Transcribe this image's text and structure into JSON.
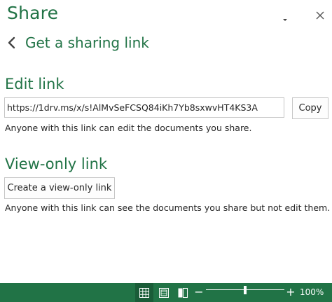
{
  "pane": {
    "title": "Share",
    "menu_icon": "chevron-down-icon",
    "close_icon": "close-icon"
  },
  "subheader": {
    "back_icon": "chevron-left-icon",
    "label": "Get a sharing link"
  },
  "edit_link": {
    "heading": "Edit link",
    "url": "https://1drv.ms/x/s!AlMvSeFCSQ84iKh7Yb8sxwvHT4KS3A",
    "copy_label": "Copy",
    "description": "Anyone with this link can edit the documents you share."
  },
  "view_only_link": {
    "heading": "View-only link",
    "create_label": "Create a view-only link",
    "description": "Anyone with this link can see the documents you share but not edit them."
  },
  "status_bar": {
    "views": [
      {
        "name": "normal-view",
        "icon": "grid-icon",
        "active": true
      },
      {
        "name": "page-layout-view",
        "icon": "page-layout-icon",
        "active": false
      },
      {
        "name": "page-break-preview",
        "icon": "page-break-icon",
        "active": false
      }
    ],
    "zoom_out": "−",
    "zoom_in": "+",
    "zoom_fraction": 0.5,
    "zoom_label": "100%"
  },
  "colors": {
    "accent": "#217346",
    "status_bar": "#217346",
    "text": "#262626",
    "border": "#c6c6c6"
  }
}
